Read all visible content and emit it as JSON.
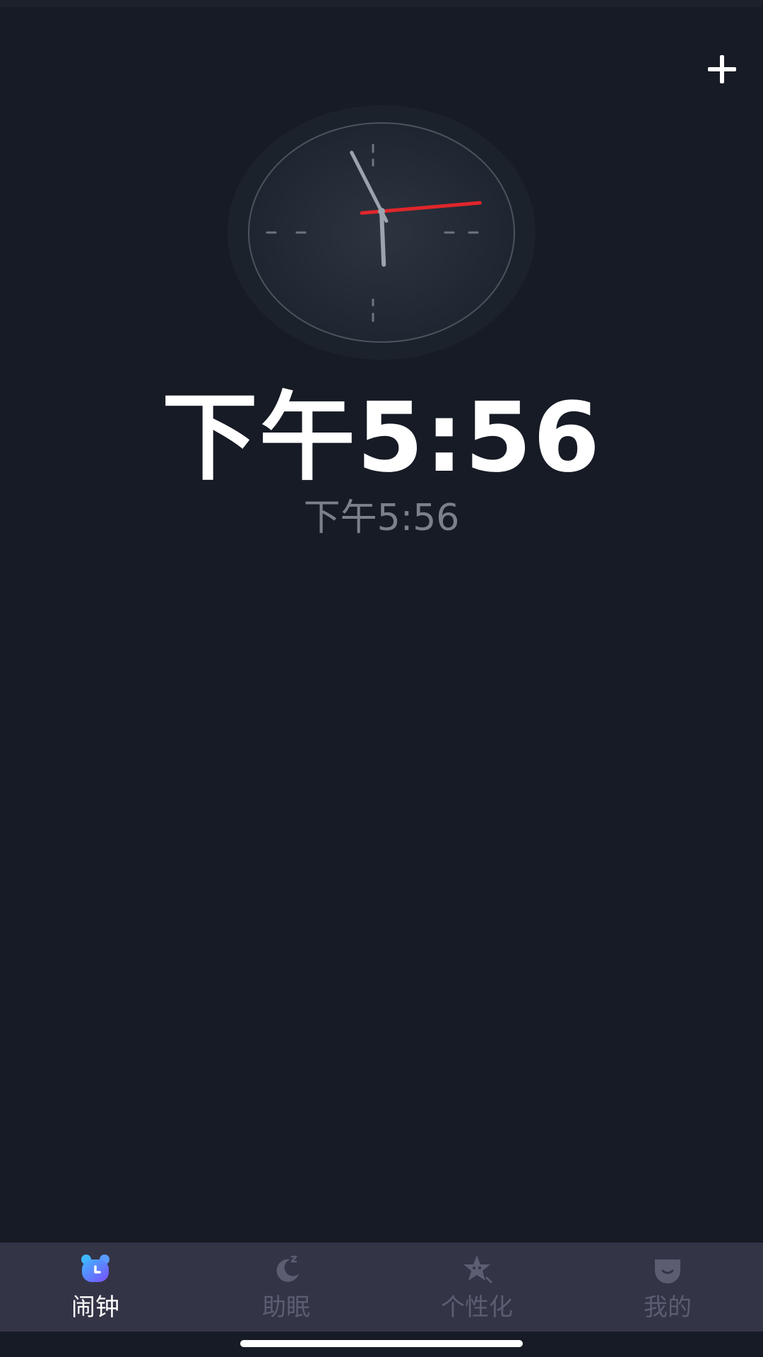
{
  "header": {
    "add_icon": "plus-icon"
  },
  "clock": {
    "hour": 5,
    "minute": 56,
    "second": 14,
    "second_hand_color": "#e0262b",
    "hand_color": "#9aa3ae"
  },
  "time": {
    "main": "下午5:56",
    "secondary": "下午5:56"
  },
  "tabs": [
    {
      "label": "闹钟",
      "icon": "alarm-bear-icon",
      "active": true
    },
    {
      "label": "助眠",
      "icon": "moon-sleep-icon",
      "active": false
    },
    {
      "label": "个性化",
      "icon": "star-personalize-icon",
      "active": false
    },
    {
      "label": "我的",
      "icon": "profile-icon",
      "active": false
    }
  ],
  "colors": {
    "background": "#161b25",
    "tab_bar": "#343447",
    "tab_active_label": "#ffffff",
    "tab_inactive_label": "#5d5d72"
  }
}
